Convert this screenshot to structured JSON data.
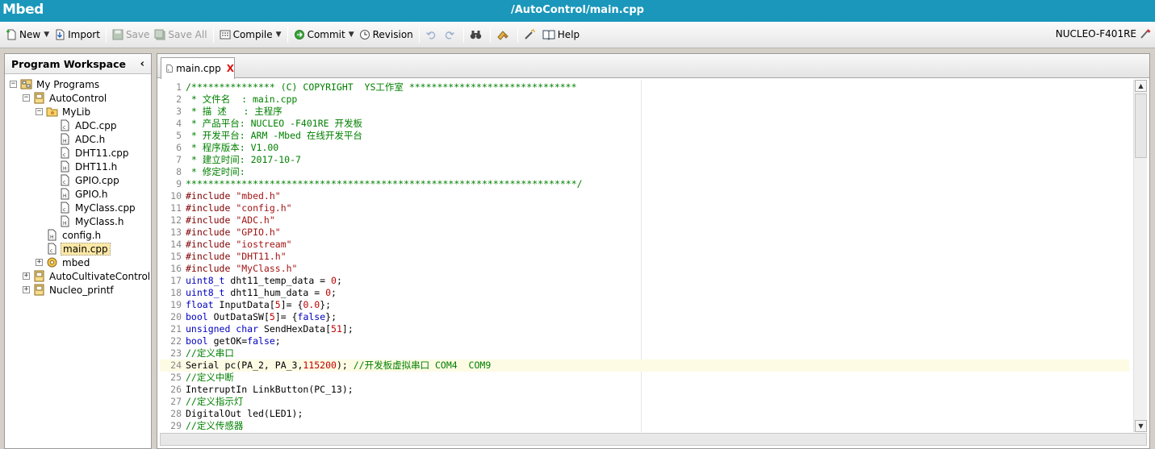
{
  "app": {
    "name": "Mbed",
    "document_title": "/AutoControl/main.cpp"
  },
  "toolbar": {
    "new": "New",
    "import": "Import",
    "save": "Save",
    "save_all": "Save All",
    "compile": "Compile",
    "commit": "Commit",
    "revision": "Revision",
    "help": "Help",
    "target": "NUCLEO-F401RE"
  },
  "sidebar": {
    "title": "Program Workspace",
    "tree": [
      {
        "label": "My Programs",
        "icon": "workspace-icon",
        "depth": 0,
        "toggle": "-"
      },
      {
        "label": "AutoControl",
        "icon": "program-icon",
        "depth": 1,
        "toggle": "-"
      },
      {
        "label": "MyLib",
        "icon": "folder-icon",
        "depth": 2,
        "toggle": "-"
      },
      {
        "label": "ADC.cpp",
        "icon": "cpp-file-icon",
        "depth": 3
      },
      {
        "label": "ADC.h",
        "icon": "header-file-icon",
        "depth": 3
      },
      {
        "label": "DHT11.cpp",
        "icon": "cpp-file-icon",
        "depth": 3
      },
      {
        "label": "DHT11.h",
        "icon": "header-file-icon",
        "depth": 3
      },
      {
        "label": "GPIO.cpp",
        "icon": "cpp-file-icon",
        "depth": 3
      },
      {
        "label": "GPIO.h",
        "icon": "header-file-icon",
        "depth": 3
      },
      {
        "label": "MyClass.cpp",
        "icon": "cpp-file-icon",
        "depth": 3
      },
      {
        "label": "MyClass.h",
        "icon": "header-file-icon",
        "depth": 3
      },
      {
        "label": "config.h",
        "icon": "header-file-icon",
        "depth": 2
      },
      {
        "label": "main.cpp",
        "icon": "cpp-file-icon",
        "depth": 2,
        "selected": true
      },
      {
        "label": "mbed",
        "icon": "library-gear-icon",
        "depth": 2,
        "toggle": "+"
      },
      {
        "label": "AutoCultivateControl",
        "icon": "program-icon",
        "depth": 1,
        "toggle": "+"
      },
      {
        "label": "Nucleo_printf",
        "icon": "program-icon",
        "depth": 1,
        "toggle": "+"
      }
    ]
  },
  "editor": {
    "tab_label": "main.cpp",
    "current_line": 24,
    "lines": [
      {
        "n": "1",
        "segs": [
          {
            "c": "cm",
            "t": "/*************** (C) COPYRIGHT  YS工作室 ******************************"
          }
        ]
      },
      {
        "n": "2",
        "segs": [
          {
            "c": "cm",
            "t": " * 文件名  : main.cpp"
          }
        ]
      },
      {
        "n": "3",
        "segs": [
          {
            "c": "cm",
            "t": " * 描 述   : 主程序"
          }
        ]
      },
      {
        "n": "4",
        "segs": [
          {
            "c": "cm",
            "t": " * 产品平台: NUCLEO -F401RE 开发板"
          }
        ]
      },
      {
        "n": "5",
        "segs": [
          {
            "c": "cm",
            "t": " * 开发平台: ARM -Mbed 在线开发平台"
          }
        ]
      },
      {
        "n": "6",
        "segs": [
          {
            "c": "cm",
            "t": " * 程序版本: V1.00"
          }
        ]
      },
      {
        "n": "7",
        "segs": [
          {
            "c": "cm",
            "t": " * 建立时间: 2017-10-7"
          }
        ]
      },
      {
        "n": "8",
        "segs": [
          {
            "c": "cm",
            "t": " * 修定时间:"
          }
        ]
      },
      {
        "n": "9",
        "segs": [
          {
            "c": "cm",
            "t": "**********************************************************************/"
          }
        ]
      },
      {
        "n": "10",
        "segs": [
          {
            "c": "pp",
            "t": "#include "
          },
          {
            "c": "st",
            "t": "\"mbed.h\""
          }
        ]
      },
      {
        "n": "11",
        "segs": [
          {
            "c": "pp",
            "t": "#include "
          },
          {
            "c": "st",
            "t": "\"config.h\""
          }
        ]
      },
      {
        "n": "12",
        "segs": [
          {
            "c": "pp",
            "t": "#include "
          },
          {
            "c": "st",
            "t": "\"ADC.h\""
          }
        ]
      },
      {
        "n": "13",
        "segs": [
          {
            "c": "pp",
            "t": "#include "
          },
          {
            "c": "st",
            "t": "\"GPIO.h\""
          }
        ]
      },
      {
        "n": "14",
        "segs": [
          {
            "c": "pp",
            "t": "#include "
          },
          {
            "c": "st",
            "t": "\"iostream\""
          }
        ]
      },
      {
        "n": "15",
        "segs": [
          {
            "c": "pp",
            "t": "#include "
          },
          {
            "c": "st",
            "t": "\"DHT11.h\""
          }
        ]
      },
      {
        "n": "16",
        "segs": [
          {
            "c": "pp",
            "t": "#include "
          },
          {
            "c": "st",
            "t": "\"MyClass.h\""
          }
        ]
      },
      {
        "n": "17",
        "segs": [
          {
            "c": "kw",
            "t": "uint8_t"
          },
          {
            "c": "tx",
            "t": " dht11_temp_data = "
          },
          {
            "c": "nu",
            "t": "0"
          },
          {
            "c": "tx",
            "t": ";"
          }
        ]
      },
      {
        "n": "18",
        "segs": [
          {
            "c": "kw",
            "t": "uint8_t"
          },
          {
            "c": "tx",
            "t": " dht11_hum_data = "
          },
          {
            "c": "nu",
            "t": "0"
          },
          {
            "c": "tx",
            "t": ";"
          }
        ]
      },
      {
        "n": "19",
        "segs": [
          {
            "c": "kw",
            "t": "float"
          },
          {
            "c": "tx",
            "t": " InputData["
          },
          {
            "c": "nu",
            "t": "5"
          },
          {
            "c": "tx",
            "t": "]= {"
          },
          {
            "c": "nu",
            "t": "0.0"
          },
          {
            "c": "tx",
            "t": "};"
          }
        ]
      },
      {
        "n": "20",
        "segs": [
          {
            "c": "kw",
            "t": "bool"
          },
          {
            "c": "tx",
            "t": " OutDataSW["
          },
          {
            "c": "nu",
            "t": "5"
          },
          {
            "c": "tx",
            "t": "]= {"
          },
          {
            "c": "kw",
            "t": "false"
          },
          {
            "c": "tx",
            "t": "};"
          }
        ]
      },
      {
        "n": "21",
        "segs": [
          {
            "c": "kw",
            "t": "unsigned char"
          },
          {
            "c": "tx",
            "t": " SendHexData["
          },
          {
            "c": "nu",
            "t": "51"
          },
          {
            "c": "tx",
            "t": "];"
          }
        ]
      },
      {
        "n": "22",
        "segs": [
          {
            "c": "kw",
            "t": "bool"
          },
          {
            "c": "tx",
            "t": " getOK="
          },
          {
            "c": "kw",
            "t": "false"
          },
          {
            "c": "tx",
            "t": ";"
          }
        ]
      },
      {
        "n": "23",
        "segs": [
          {
            "c": "cm",
            "t": "//定义串口"
          }
        ]
      },
      {
        "n": "24",
        "segs": [
          {
            "c": "tx",
            "t": "Serial pc(PA_2, PA_3,"
          },
          {
            "c": "nu",
            "t": "115200"
          },
          {
            "c": "tx",
            "t": "); "
          },
          {
            "c": "cm",
            "t": "//开发板虚拟串口 COM4  COM9"
          }
        ]
      },
      {
        "n": "25",
        "segs": [
          {
            "c": "cm",
            "t": "//定义中断"
          }
        ]
      },
      {
        "n": "26",
        "segs": [
          {
            "c": "tx",
            "t": "InterruptIn LinkButton(PC_13);"
          }
        ]
      },
      {
        "n": "27",
        "segs": [
          {
            "c": "cm",
            "t": "//定义指示灯"
          }
        ]
      },
      {
        "n": "28",
        "segs": [
          {
            "c": "tx",
            "t": "DigitalOut led(LED1);"
          }
        ]
      },
      {
        "n": "29",
        "segs": [
          {
            "c": "cm",
            "t": "//定义传感器"
          }
        ]
      }
    ]
  }
}
